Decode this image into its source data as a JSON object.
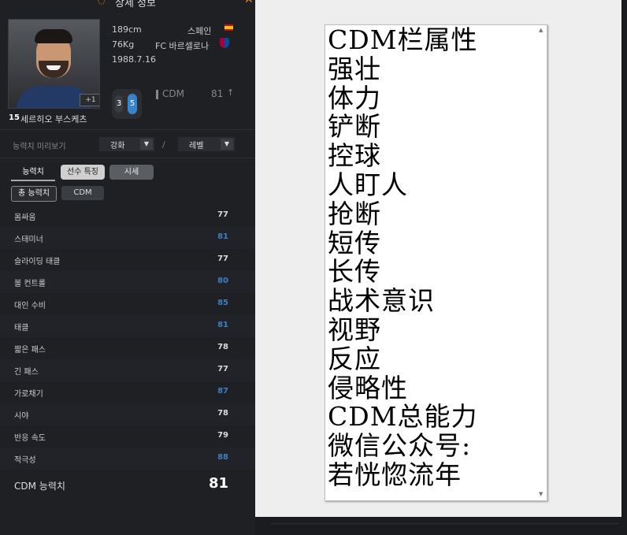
{
  "panel": {
    "title": "상세 정보",
    "player": {
      "height": "189cm",
      "weight": "76Kg",
      "birth": "1988.7.16",
      "country": "스페인",
      "club": "FC 바르셀로나",
      "number": "15",
      "name": "세르히오 부스케츠",
      "plus": "+1",
      "pos_a": "3",
      "pos_b": "5",
      "position": "CDM",
      "position_rating": "81",
      "arrow": "↑"
    },
    "preview": {
      "label": "능력치 미리보기",
      "enhance": "강화",
      "level": "레벨",
      "slash": "/"
    },
    "tabs": [
      "능력치",
      "선수 특징",
      "시세"
    ],
    "subtabs": [
      "총 능력치",
      "CDM"
    ],
    "stats": [
      {
        "name": "몸싸움",
        "value": "77",
        "color": "#dddddd"
      },
      {
        "name": "스태미너",
        "value": "81",
        "color": "#3d7fc4"
      },
      {
        "name": "슬라이딩 태클",
        "value": "77",
        "color": "#dddddd"
      },
      {
        "name": "볼 컨트롤",
        "value": "80",
        "color": "#3d7fc4"
      },
      {
        "name": "대인 수비",
        "value": "85",
        "color": "#3d7fc4"
      },
      {
        "name": "태클",
        "value": "81",
        "color": "#3d7fc4"
      },
      {
        "name": "짧은 패스",
        "value": "78",
        "color": "#dddddd"
      },
      {
        "name": "긴 패스",
        "value": "77",
        "color": "#dddddd"
      },
      {
        "name": "가로채기",
        "value": "87",
        "color": "#3d7fc4"
      },
      {
        "name": "시야",
        "value": "78",
        "color": "#dddddd"
      },
      {
        "name": "반응 속도",
        "value": "79",
        "color": "#dddddd"
      },
      {
        "name": "적극성",
        "value": "88",
        "color": "#3d7fc4"
      }
    ],
    "total": {
      "name": "CDM 능력치",
      "value": "81"
    }
  },
  "notes": {
    "lines": [
      "CDM栏属性",
      "强壮",
      "体力",
      "铲断",
      "控球",
      "人盯人",
      "抢断",
      "短传",
      "长传",
      "战术意识",
      "视野",
      "反应",
      "侵略性",
      "CDM总能力",
      "微信公众号:",
      "若恍惚流年"
    ]
  }
}
